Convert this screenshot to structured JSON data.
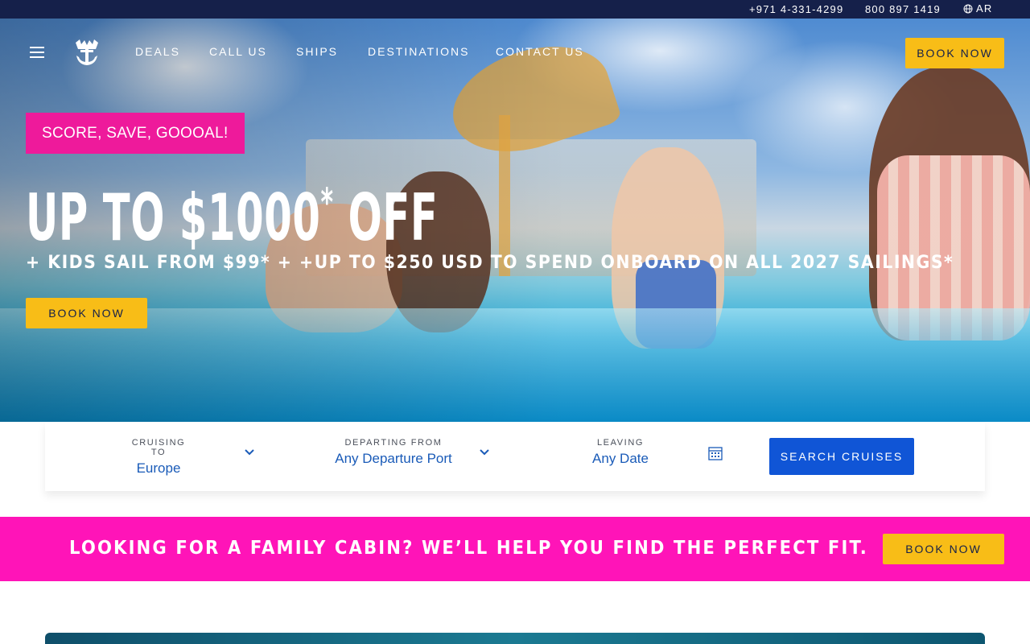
{
  "topbar": {
    "phone_1": "+971 4-331-4299",
    "phone_2": "800 897 1419",
    "language": "AR",
    "background_color": "#15204a"
  },
  "nav": {
    "menu_icon": "hamburger-menu-icon",
    "logo_icon": "crown-anchor-logo-icon",
    "links": [
      "DEALS",
      "CALL US",
      "SHIPS",
      "DESTINATIONS",
      "CONTACT US"
    ],
    "book_now": "BOOK NOW"
  },
  "hero": {
    "badge": "SCORE, SAVE, GOOOAL!",
    "headline": "UP TO $1000",
    "headline_asterisk": "*",
    "headline_suffix": " OFF",
    "subline": "+ KIDS SAIL FROM $99* + +UP TO $250 USD TO SPEND ONBOARD ON ALL 2027 SAILINGS*",
    "book_now": "BOOK NOW",
    "badge_color": "#ee1a9b"
  },
  "search": {
    "cruising_to": {
      "label": "CRUISING TO",
      "value": "Europe"
    },
    "departing_from": {
      "label": "DEPARTING FROM",
      "value": "Any Departure Port"
    },
    "leaving": {
      "label": "LEAVING",
      "value": "Any Date"
    },
    "button": "SEARCH CRUISES",
    "button_color": "#1055d6"
  },
  "promo": {
    "text": "LOOKING FOR A FAMILY CABIN? WE’LL HELP YOU FIND THE PERFECT FIT.",
    "book_now": "BOOK NOW",
    "background_color": "#ff14b8"
  },
  "colors": {
    "accent_yellow": "#f8bd17",
    "navy": "#15204a",
    "link_blue": "#1a5bb8"
  }
}
